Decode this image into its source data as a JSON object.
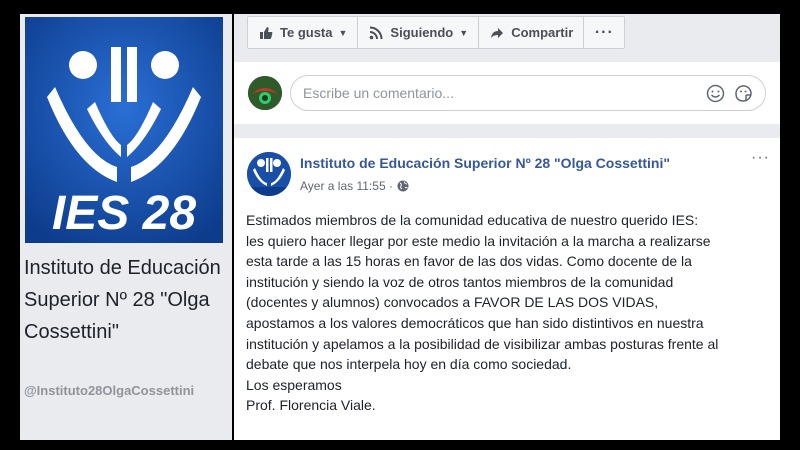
{
  "profile": {
    "logo_text": "IES 28",
    "page_name": "Instituto de Educación Superior Nº 28 \"Olga Cossettini\"",
    "handle": "@Instituto28OlgaCossettini"
  },
  "actions": {
    "like_label": "Te gusta",
    "follow_label": "Siguiendo",
    "share_label": "Compartir",
    "more_label": "···"
  },
  "comment_box": {
    "placeholder": "Escribe un comentario..."
  },
  "post": {
    "author": "Instituto de Educación Superior Nº 28 \"Olga Cossettini\"",
    "timestamp": "Ayer a las 11:55 ·",
    "more_label": "···",
    "body": "Estimados miembros de la comunidad educativa de nuestro querido IES:\nles quiero hacer llegar por este medio la invitación a la marcha a realizarse\nesta tarde a las 15 horas en favor de las dos vidas. Como docente de la\ninstitución y siendo la voz de otros tantos miembros de la comunidad\n(docentes y alumnos) convocados a FAVOR DE LAS DOS VIDAS,\napostamos a los valores democráticos que han sido distintivos en nuestra\ninstitución y apelamos a la posibilidad de visibilizar ambas posturas frente al\ndebate que nos interpela hoy en día como sociedad.\nLos esperamos\nProf. Florencia Viale."
  },
  "colors": {
    "brand_blue": "#1a4fa8",
    "link_blue": "#365899",
    "background": "#e9ebee"
  }
}
